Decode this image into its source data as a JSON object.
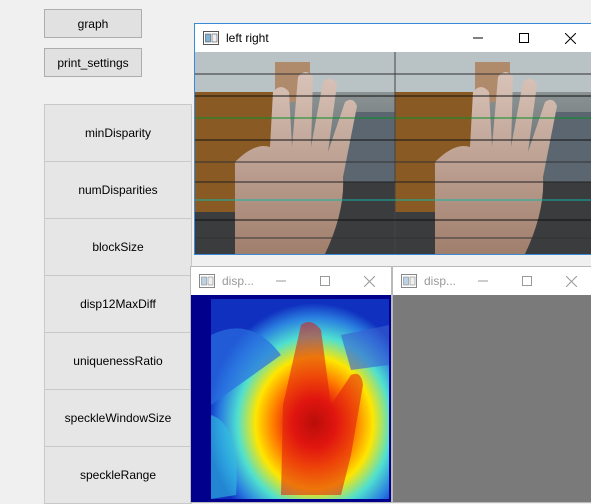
{
  "buttons": {
    "graph": "graph",
    "print_settings": "print_settings"
  },
  "params": [
    "minDisparity",
    "numDisparities",
    "blockSize",
    "disp12MaxDiff",
    "uniquenessRatio",
    "speckleWindowSize",
    "speckleRange"
  ],
  "windows": {
    "left_right": {
      "title": "left right"
    },
    "disparity_1": {
      "title": "disp..."
    },
    "disparity_2": {
      "title": "disp..."
    }
  },
  "colors": {
    "active_border": "#3b8ad8",
    "inactive_border": "#b9b9b9",
    "disparity_background": "#00008c",
    "second_disparity_fill": "#7a7a7a"
  },
  "icons": [
    "app-window-icon",
    "minimize-icon",
    "maximize-icon",
    "close-icon"
  ]
}
